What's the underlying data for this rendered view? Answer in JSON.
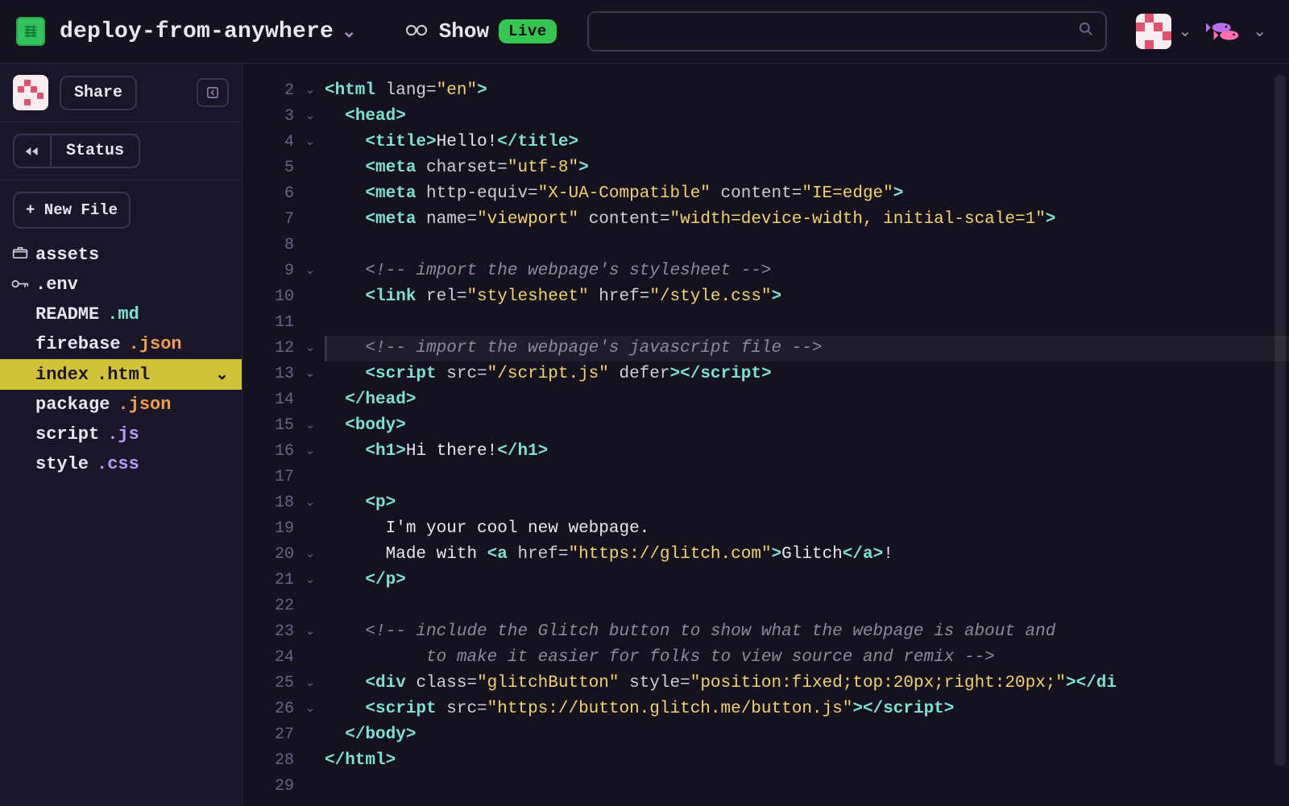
{
  "header": {
    "project_name": "deploy-from-anywhere",
    "show_label": "Show",
    "live_label": "Live",
    "search_placeholder": ""
  },
  "sidebar": {
    "share_label": "Share",
    "status_label": "Status",
    "new_file_label": "+ New File",
    "files": [
      {
        "icon": "box",
        "name": "assets",
        "ext": ""
      },
      {
        "icon": "key",
        "name": ".env",
        "ext": ""
      },
      {
        "icon": "",
        "name": "README",
        "ext": ".md",
        "ext_class": "md"
      },
      {
        "icon": "",
        "name": "firebase",
        "ext": ".json",
        "ext_class": "json"
      },
      {
        "icon": "",
        "name": "index",
        "ext": ".html",
        "ext_class": "html",
        "active": true
      },
      {
        "icon": "",
        "name": "package",
        "ext": ".json",
        "ext_class": "json"
      },
      {
        "icon": "",
        "name": "script",
        "ext": ".js",
        "ext_class": "js"
      },
      {
        "icon": "",
        "name": "style",
        "ext": ".css",
        "ext_class": "css"
      }
    ]
  },
  "editor": {
    "highlighted_line": 12,
    "lines": [
      {
        "n": 2,
        "fold": true,
        "tokens": [
          {
            "t": "tag",
            "v": "<html"
          },
          {
            "t": "attr",
            "v": " lang="
          },
          {
            "t": "str",
            "v": "\"en\""
          },
          {
            "t": "tag",
            "v": ">"
          }
        ]
      },
      {
        "n": 3,
        "fold": true,
        "indent": 2,
        "tokens": [
          {
            "t": "tag",
            "v": "<head>"
          }
        ]
      },
      {
        "n": 4,
        "fold": true,
        "indent": 4,
        "tokens": [
          {
            "t": "tag",
            "v": "<title>"
          },
          {
            "t": "text",
            "v": "Hello!"
          },
          {
            "t": "tag",
            "v": "</title>"
          }
        ]
      },
      {
        "n": 5,
        "indent": 4,
        "tokens": [
          {
            "t": "tag",
            "v": "<meta"
          },
          {
            "t": "attr",
            "v": " charset="
          },
          {
            "t": "str",
            "v": "\"utf-8\""
          },
          {
            "t": "tag",
            "v": ">"
          }
        ]
      },
      {
        "n": 6,
        "indent": 4,
        "tokens": [
          {
            "t": "tag",
            "v": "<meta"
          },
          {
            "t": "attr",
            "v": " http-equiv="
          },
          {
            "t": "str",
            "v": "\"X-UA-Compatible\""
          },
          {
            "t": "attr",
            "v": " content="
          },
          {
            "t": "str",
            "v": "\"IE=edge\""
          },
          {
            "t": "tag",
            "v": ">"
          }
        ]
      },
      {
        "n": 7,
        "indent": 4,
        "tokens": [
          {
            "t": "tag",
            "v": "<meta"
          },
          {
            "t": "attr",
            "v": " name="
          },
          {
            "t": "str",
            "v": "\"viewport\""
          },
          {
            "t": "attr",
            "v": " content="
          },
          {
            "t": "str",
            "v": "\"width=device-width, initial-scale=1\""
          },
          {
            "t": "tag",
            "v": ">"
          }
        ]
      },
      {
        "n": 8,
        "blank": true
      },
      {
        "n": 9,
        "fold": true,
        "indent": 4,
        "tokens": [
          {
            "t": "comment",
            "v": "<!-- import the webpage's stylesheet -->"
          }
        ]
      },
      {
        "n": 10,
        "indent": 4,
        "tokens": [
          {
            "t": "tag",
            "v": "<link"
          },
          {
            "t": "attr",
            "v": " rel="
          },
          {
            "t": "str",
            "v": "\"stylesheet\""
          },
          {
            "t": "attr",
            "v": " href="
          },
          {
            "t": "str",
            "v": "\"/style.css\""
          },
          {
            "t": "tag",
            "v": ">"
          }
        ]
      },
      {
        "n": 11,
        "blank": true
      },
      {
        "n": 12,
        "fold": true,
        "indent": 4,
        "hl": true,
        "tokens": [
          {
            "t": "comment",
            "v": "<!-- import the webpage's javascript file -->"
          }
        ]
      },
      {
        "n": 13,
        "fold": true,
        "indent": 4,
        "tokens": [
          {
            "t": "tag",
            "v": "<script"
          },
          {
            "t": "attr",
            "v": " src="
          },
          {
            "t": "str",
            "v": "\"/script.js\""
          },
          {
            "t": "attr",
            "v": " defer"
          },
          {
            "t": "tag",
            "v": "></"
          },
          {
            "t": "tag",
            "v": "script>"
          }
        ]
      },
      {
        "n": 14,
        "indent": 2,
        "tokens": [
          {
            "t": "tag",
            "v": "</head>"
          }
        ]
      },
      {
        "n": 15,
        "fold": true,
        "indent": 2,
        "tokens": [
          {
            "t": "tag",
            "v": "<body>"
          }
        ]
      },
      {
        "n": 16,
        "fold": true,
        "indent": 4,
        "tokens": [
          {
            "t": "tag",
            "v": "<h1>"
          },
          {
            "t": "text",
            "v": "Hi there!"
          },
          {
            "t": "tag",
            "v": "</h1>"
          }
        ]
      },
      {
        "n": 17,
        "blank": true
      },
      {
        "n": 18,
        "fold": true,
        "indent": 4,
        "tokens": [
          {
            "t": "tag",
            "v": "<p>"
          }
        ]
      },
      {
        "n": 19,
        "indent": 6,
        "tokens": [
          {
            "t": "text",
            "v": "I'm your cool new webpage."
          }
        ]
      },
      {
        "n": 20,
        "fold": true,
        "indent": 6,
        "tokens": [
          {
            "t": "text",
            "v": "Made with "
          },
          {
            "t": "tag",
            "v": "<a"
          },
          {
            "t": "attr",
            "v": " href="
          },
          {
            "t": "str",
            "v": "\"https://glitch.com\""
          },
          {
            "t": "tag",
            "v": ">"
          },
          {
            "t": "text",
            "v": "Glitch"
          },
          {
            "t": "tag",
            "v": "</a>"
          },
          {
            "t": "text",
            "v": "!"
          }
        ]
      },
      {
        "n": 21,
        "fold": true,
        "indent": 4,
        "tokens": [
          {
            "t": "tag",
            "v": "</p>"
          }
        ]
      },
      {
        "n": 22,
        "blank": true
      },
      {
        "n": 23,
        "fold": true,
        "indent": 4,
        "tokens": [
          {
            "t": "comment",
            "v": "<!-- include the Glitch button to show what the webpage is about and"
          }
        ]
      },
      {
        "n": 24,
        "indent": 10,
        "tokens": [
          {
            "t": "comment",
            "v": "to make it easier for folks to view source and remix -->"
          }
        ]
      },
      {
        "n": 25,
        "fold": true,
        "indent": 4,
        "tokens": [
          {
            "t": "tag",
            "v": "<div"
          },
          {
            "t": "attr",
            "v": " class="
          },
          {
            "t": "str",
            "v": "\"glitchButton\""
          },
          {
            "t": "attr",
            "v": " style="
          },
          {
            "t": "str",
            "v": "\"position:fixed;top:20px;right:20px;\""
          },
          {
            "t": "tag",
            "v": "></di"
          }
        ]
      },
      {
        "n": 26,
        "fold": true,
        "indent": 4,
        "tokens": [
          {
            "t": "tag",
            "v": "<script"
          },
          {
            "t": "attr",
            "v": " src="
          },
          {
            "t": "str",
            "v": "\"https://button.glitch.me/button.js\""
          },
          {
            "t": "tag",
            "v": "></"
          },
          {
            "t": "tag",
            "v": "script>"
          }
        ]
      },
      {
        "n": 27,
        "indent": 2,
        "tokens": [
          {
            "t": "tag",
            "v": "</body>"
          }
        ]
      },
      {
        "n": 28,
        "indent": 0,
        "tokens": [
          {
            "t": "tag",
            "v": "</html>"
          }
        ]
      },
      {
        "n": 29,
        "blank": true
      }
    ]
  }
}
